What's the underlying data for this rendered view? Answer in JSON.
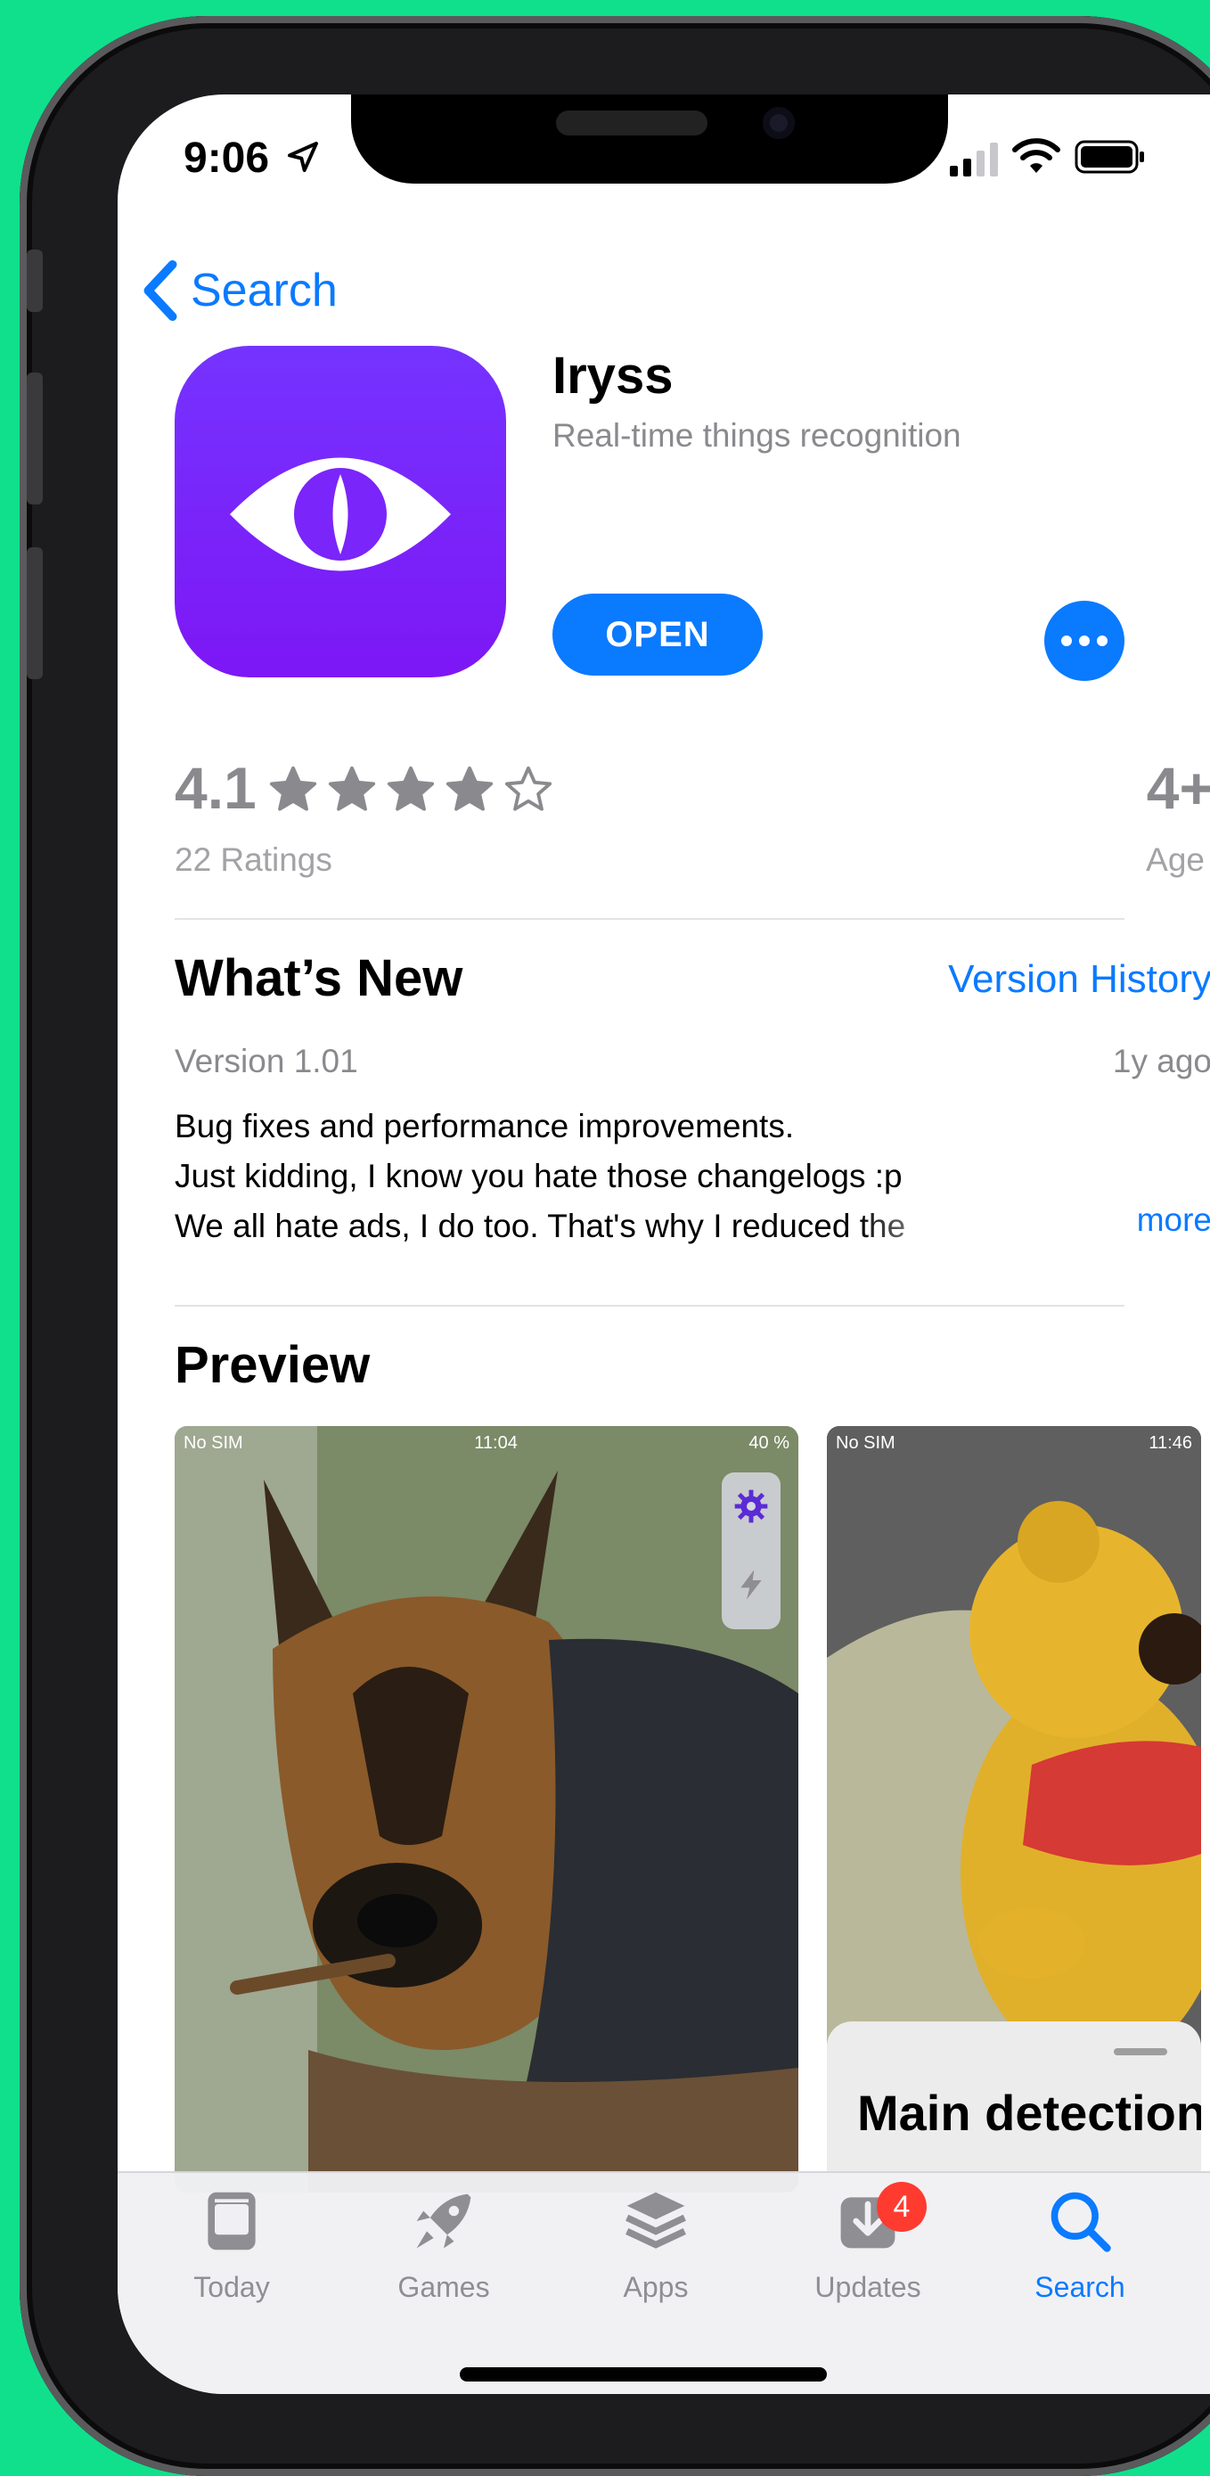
{
  "status_bar": {
    "time": "9:06"
  },
  "nav": {
    "back_label": "Search"
  },
  "app": {
    "name": "Iryss",
    "subtitle": "Real-time things recognition",
    "open_label": "OPEN",
    "icon_color": "#7a25f9"
  },
  "ratings": {
    "value": "4.1",
    "stars_filled": 4,
    "stars_total": 5,
    "count_label": "22 Ratings",
    "age_value": "4+",
    "age_label": "Age"
  },
  "whats_new": {
    "title": "What’s New",
    "version_history_label": "Version History",
    "version": "Version 1.01",
    "ago": "1y ago",
    "notes": [
      "Bug fixes and performance improvements.",
      "Just kidding, I know you hate those changelogs :p",
      "We all hate ads, I do too. That's why I reduced the"
    ],
    "more_label": "more"
  },
  "preview": {
    "title": "Preview",
    "screenshots": [
      {
        "carrier": "No SIM",
        "time": "11:04",
        "battery": "40 %"
      },
      {
        "carrier": "No SIM",
        "time": "11:46",
        "sheet_title": "Main detection"
      }
    ]
  },
  "tab_bar": {
    "tabs": [
      {
        "label": "Today",
        "icon": "today-icon"
      },
      {
        "label": "Games",
        "icon": "rocket-icon"
      },
      {
        "label": "Apps",
        "icon": "layers-icon"
      },
      {
        "label": "Updates",
        "icon": "download-icon",
        "badge": "4"
      },
      {
        "label": "Search",
        "icon": "search-icon",
        "active": true
      }
    ]
  },
  "colors": {
    "accent": "#0a7aff",
    "background": "#10e08c",
    "badge": "#ff3b30"
  }
}
